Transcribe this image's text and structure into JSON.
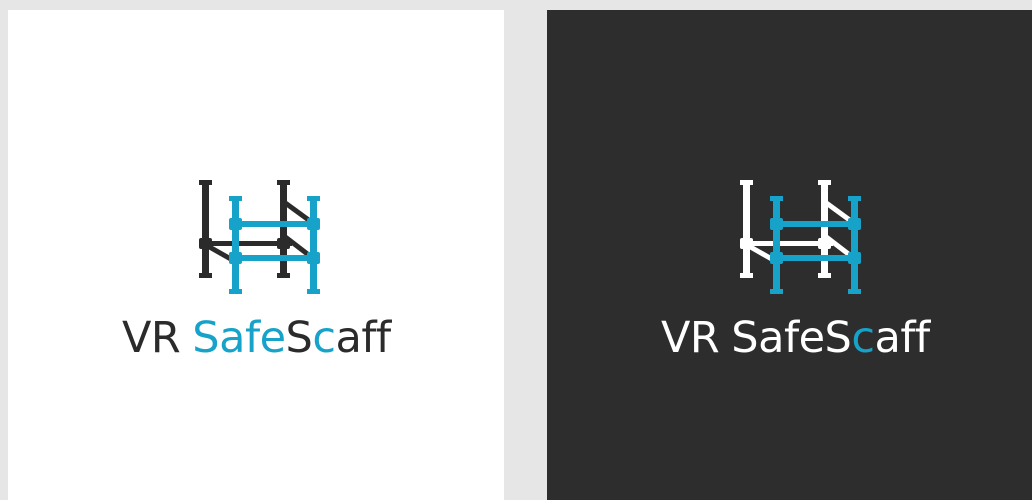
{
  "brand": {
    "part_vr": "VR",
    "part_safe": "Safe",
    "part_s": "S",
    "part_c": "c",
    "part_aff": "aff"
  },
  "colors": {
    "page_background": "#e6e6e6",
    "light_panel": "#ffffff",
    "dark_panel": "#2e2d2e",
    "accent_blue": "#17a3c9",
    "dark_text": "#2b2b2b",
    "light_text": "#ffffff"
  },
  "icons": {
    "logo_mark": "scaffold-frame-icon"
  }
}
